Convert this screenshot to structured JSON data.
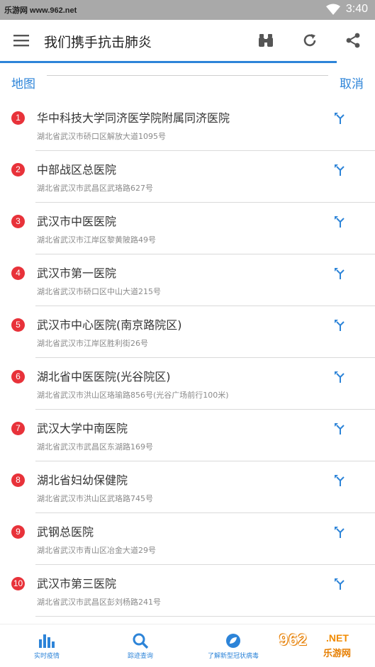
{
  "status_bar": {
    "watermark": "乐游网 www.962.net",
    "time": "3:40"
  },
  "app_bar": {
    "title": "我们携手抗击肺炎",
    "icons": [
      "menu-icon",
      "binoculars-icon",
      "refresh-icon",
      "share-icon"
    ]
  },
  "search": {
    "map_label": "地图",
    "cancel_label": "取消"
  },
  "hospitals": [
    {
      "index": "1",
      "name": "华中科技大学同济医学院附属同济医院",
      "address": "湖北省武汉市硚口区解放大道1095号"
    },
    {
      "index": "2",
      "name": "中部战区总医院",
      "address": "湖北省武汉市武昌区武珞路627号"
    },
    {
      "index": "3",
      "name": "武汉市中医医院",
      "address": "湖北省武汉市江岸区黎黄陂路49号"
    },
    {
      "index": "4",
      "name": "武汉市第一医院",
      "address": "湖北省武汉市硚口区中山大道215号"
    },
    {
      "index": "5",
      "name": "武汉市中心医院(南京路院区)",
      "address": "湖北省武汉市江岸区胜利街26号"
    },
    {
      "index": "6",
      "name": "湖北省中医医院(光谷院区)",
      "address": "湖北省武汉市洪山区珞瑜路856号(光谷广场前行100米)"
    },
    {
      "index": "7",
      "name": "武汉大学中南医院",
      "address": "湖北省武汉市武昌区东湖路169号"
    },
    {
      "index": "8",
      "name": "湖北省妇幼保健院",
      "address": "湖北省武汉市洪山区武珞路745号"
    },
    {
      "index": "9",
      "name": "武钢总医院",
      "address": "湖北省武汉市青山区冶金大道29号"
    },
    {
      "index": "10",
      "name": "武汉市第三医院",
      "address": "湖北省武汉市武昌区彭刘杨路241号"
    }
  ],
  "bottom_nav": [
    {
      "label": "实时疫情",
      "icon": "bar-chart-icon"
    },
    {
      "label": "踪迹查询",
      "icon": "search-icon"
    },
    {
      "label": "了解新型冠状病毒",
      "icon": "leaf-icon"
    }
  ],
  "watermark_logo": {
    "number": "962",
    "suffix": ".NET",
    "text": "乐游网"
  },
  "colors": {
    "accent": "#2d84d8",
    "badge": "#e8323a",
    "status_bar": "#a9a9a9"
  }
}
